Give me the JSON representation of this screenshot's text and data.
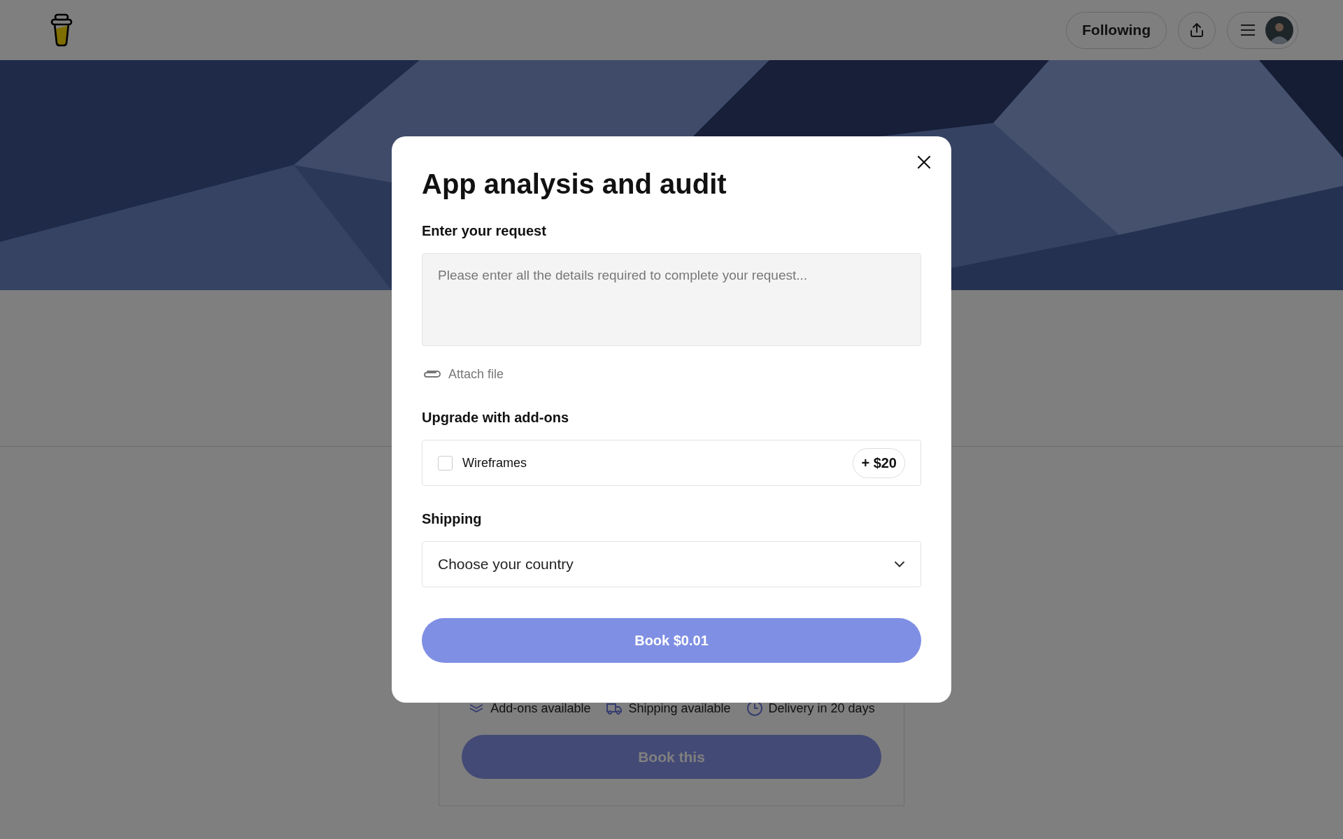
{
  "header": {
    "following_button": "Following"
  },
  "modal": {
    "title": "App analysis and audit",
    "request": {
      "label": "Enter your request",
      "placeholder": "Please enter all the details required to complete your request..."
    },
    "attach": "Attach file",
    "addons": {
      "heading": "Upgrade with add-ons",
      "items": [
        {
          "name": "Wireframes",
          "price": "+ $20",
          "checked": false
        }
      ]
    },
    "shipping": {
      "heading": "Shipping",
      "value": "Choose your country"
    },
    "book_button": "Book $0.01"
  },
  "service_card": {
    "features": [
      {
        "kind": "addons",
        "text": "Add-ons available"
      },
      {
        "kind": "shipping",
        "text": "Shipping available"
      },
      {
        "kind": "delivery",
        "text": "Delivery in 20 days"
      }
    ],
    "button": "Book this"
  }
}
